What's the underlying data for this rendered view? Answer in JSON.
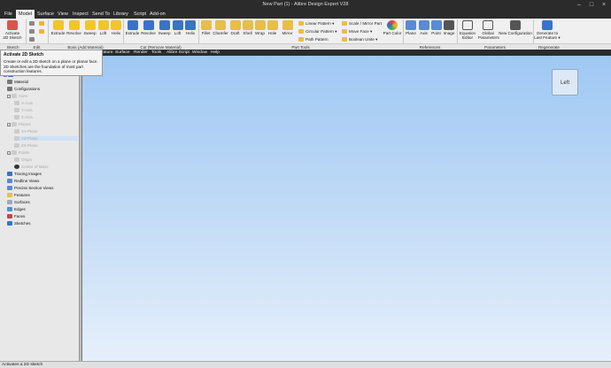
{
  "window": {
    "title": "New Part (1) - Alibre Design Expert V28"
  },
  "menubar": {
    "items": [
      "File",
      "Model",
      "Surface",
      "View",
      "Inspect",
      "Send To",
      "Library",
      "Script",
      "Add-on"
    ],
    "active": "Model"
  },
  "ribbon": {
    "sketch": {
      "activate_label": "Activate",
      "activate_label2": "2D Sketch"
    },
    "boss": [
      "Extrude",
      "Revolve",
      "Sweep",
      "Loft",
      "Helix"
    ],
    "cut": [
      "Extrude",
      "Revolve",
      "Sweep",
      "Loft",
      "Helix"
    ],
    "part_tools": [
      "Fillet",
      "Chamfer",
      "Draft",
      "Shell",
      "Wrap",
      "Hole",
      "Mirror"
    ],
    "pattern": [
      "Linear Pattern",
      "Circular Pattern",
      "Path Pattern"
    ],
    "scale": [
      "Scale / Mirror Part",
      "Move Face",
      "Boolean Unite"
    ],
    "part_color": "Part Color",
    "references": [
      "Plane",
      "Axis",
      "Point",
      "Image"
    ],
    "parameters": {
      "equation": "Equation",
      "equation2": "Editor",
      "global": "Global",
      "global2": "Parameters",
      "new_config": "New Configuration"
    },
    "regenerate": {
      "label": "Generate to",
      "label2": "Last Feature"
    },
    "groups": [
      "Sketch",
      "Edit",
      "Boss (Add Material)",
      "Cut (Remove Material)",
      "Part Tools",
      "References",
      "Parameters",
      "Regenerate"
    ]
  },
  "submenu": [
    "Feature",
    "Surface",
    "Render",
    "Tools",
    "Alibre Script",
    "Window",
    "Help"
  ],
  "tooltip": {
    "title": "Activate 2D Sketch",
    "desc": "Create or edit a 2D sketch on a plane or planar face. 2D Sketches are the foundation of most part construction features."
  },
  "tree": {
    "nodes": [
      {
        "label": "Material",
        "dim": false
      },
      {
        "label": "Configurations",
        "dim": false
      },
      {
        "label": "Axes",
        "dim": true
      },
      {
        "label": "X-Axis",
        "dim": true
      },
      {
        "label": "Y-Axis",
        "dim": true
      },
      {
        "label": "Z-Axis",
        "dim": true
      },
      {
        "label": "Planes",
        "dim": true
      },
      {
        "label": "XY-Plane",
        "dim": true
      },
      {
        "label": "YZ-Plane",
        "dim": true
      },
      {
        "label": "ZX-Plane",
        "dim": true
      },
      {
        "label": "Points",
        "dim": true
      },
      {
        "label": "Origin",
        "dim": true
      },
      {
        "label": "Center of Mass",
        "dim": true
      },
      {
        "label": "Tracing Images",
        "dim": false
      },
      {
        "label": "Redline Views",
        "dim": false
      },
      {
        "label": "Precise Section Views",
        "dim": false
      },
      {
        "label": "Features",
        "dim": false
      },
      {
        "label": "Surfaces",
        "dim": false
      },
      {
        "label": "Edges",
        "dim": false
      },
      {
        "label": "Faces",
        "dim": false
      },
      {
        "label": "Sketches",
        "dim": false
      }
    ]
  },
  "viewcube": {
    "label": "Left"
  },
  "status": {
    "text": "Activates a 2D sketch"
  },
  "colors": {
    "accent": "#2b2b2b",
    "viewport_top": "#9fc8f4",
    "viewport_bottom": "#e6f0fb"
  }
}
